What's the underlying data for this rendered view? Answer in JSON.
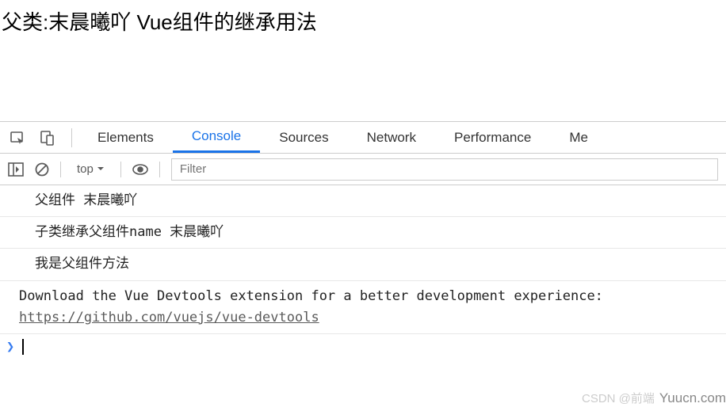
{
  "page": {
    "title": "父类:末晨曦吖 Vue组件的继承用法"
  },
  "devtools": {
    "tabs": {
      "elements": "Elements",
      "console": "Console",
      "sources": "Sources",
      "network": "Network",
      "performance": "Performance",
      "memory": "Me"
    },
    "toolbar": {
      "context": "top",
      "filter_placeholder": "Filter"
    },
    "console": {
      "line1": "父组件 末晨曦吖",
      "line2": "子类继承父组件name 末晨曦吖",
      "line3": "我是父组件方法",
      "msg_text": "Download the Vue Devtools extension for a better development experience:",
      "msg_link": "https://github.com/vuejs/vue-devtools",
      "prompt": "❯"
    }
  },
  "watermark": {
    "w1": "CSDN @前端",
    "w2": "Yuucn.com"
  }
}
